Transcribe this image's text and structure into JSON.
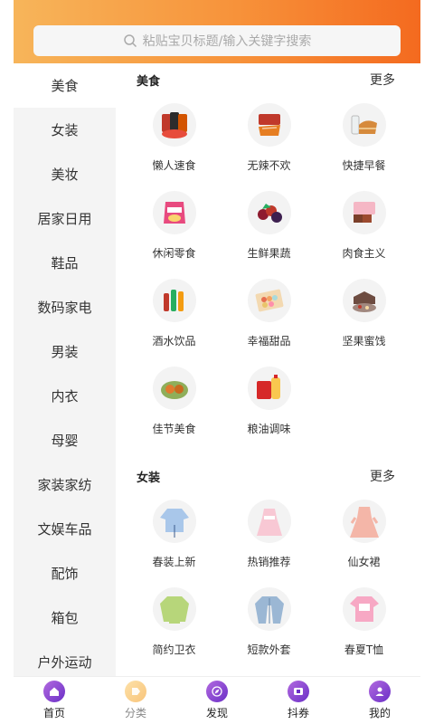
{
  "search": {
    "placeholder": "粘贴宝贝标题/输入关键字搜索"
  },
  "colors": {
    "header_start": "#f7b55a",
    "header_end": "#f46a1f",
    "nav_active": "#6a2fc6"
  },
  "sidebar": {
    "items": [
      {
        "label": "美食",
        "active": true
      },
      {
        "label": "女装"
      },
      {
        "label": "美妆"
      },
      {
        "label": "居家日用"
      },
      {
        "label": "鞋品"
      },
      {
        "label": "数码家电"
      },
      {
        "label": "男装"
      },
      {
        "label": "内衣"
      },
      {
        "label": "母婴"
      },
      {
        "label": "家装家纺"
      },
      {
        "label": "文娱车品"
      },
      {
        "label": "配饰"
      },
      {
        "label": "箱包"
      },
      {
        "label": "户外运动"
      }
    ]
  },
  "sections": [
    {
      "title": "美食",
      "more": "更多",
      "items": [
        {
          "label": "懒人速食",
          "icon": "instant-food-icon"
        },
        {
          "label": "无辣不欢",
          "icon": "spicy-meat-icon"
        },
        {
          "label": "快捷早餐",
          "icon": "breakfast-bread-icon"
        },
        {
          "label": "休闲零食",
          "icon": "chips-snack-icon"
        },
        {
          "label": "生鲜果蔬",
          "icon": "fresh-fruit-icon"
        },
        {
          "label": "肉食主义",
          "icon": "meat-icon"
        },
        {
          "label": "酒水饮品",
          "icon": "drinks-bottles-icon"
        },
        {
          "label": "幸福甜品",
          "icon": "macaron-box-icon"
        },
        {
          "label": "坚果蜜饯",
          "icon": "nuts-box-icon"
        },
        {
          "label": "佳节美食",
          "icon": "mooncake-icon"
        },
        {
          "label": "粮油调味",
          "icon": "rice-oil-icon"
        }
      ]
    },
    {
      "title": "女装",
      "more": "更多",
      "items": [
        {
          "label": "春装上新",
          "icon": "blouse-icon"
        },
        {
          "label": "热销推荐",
          "icon": "pink-dress-icon"
        },
        {
          "label": "仙女裙",
          "icon": "fairy-dress-icon"
        },
        {
          "label": "简约卫衣",
          "icon": "sweatshirt-icon"
        },
        {
          "label": "短款外套",
          "icon": "denim-jacket-icon"
        },
        {
          "label": "春夏T恤",
          "icon": "tshirt-icon"
        }
      ]
    }
  ],
  "bottom_nav": [
    {
      "label": "首页",
      "icon": "home-icon",
      "active": true
    },
    {
      "label": "分类",
      "icon": "category-tag-icon",
      "active": false
    },
    {
      "label": "发现",
      "icon": "compass-icon",
      "active": true
    },
    {
      "label": "抖券",
      "icon": "coupon-icon",
      "active": true
    },
    {
      "label": "我的",
      "icon": "user-icon",
      "active": true
    }
  ]
}
